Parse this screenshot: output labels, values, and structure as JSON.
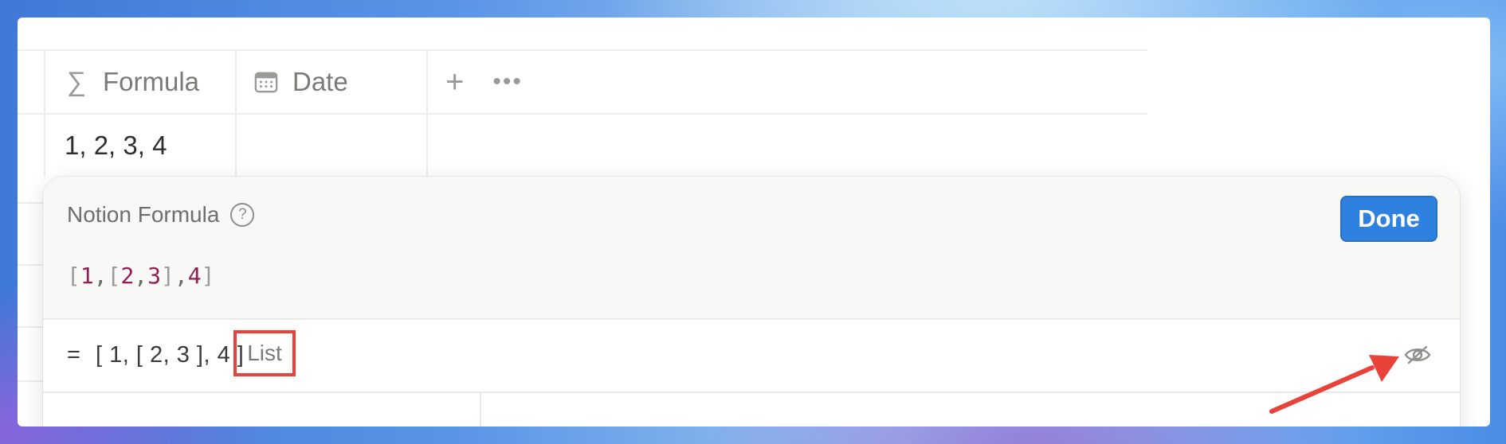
{
  "table": {
    "headers": [
      {
        "icon": "sigma-icon",
        "glyph": "∑",
        "label": "Formula"
      },
      {
        "icon": "calendar-icon",
        "label": "Date"
      }
    ],
    "row1": {
      "formula_value": "1, 2, 3, 4"
    }
  },
  "popup": {
    "title": "Notion Formula",
    "help_glyph": "?",
    "done_label": "Done",
    "formula": {
      "lb1": "[",
      "n1": "1",
      "c1": ",",
      "lb2": "[",
      "n2": "2",
      "c2": ",",
      "n3": "3",
      "rb2": "]",
      "c3": ",",
      "n4": "4",
      "rb1": "]"
    },
    "result": {
      "equals": "=",
      "value": "[ 1, [ 2, 3 ], 4 ]",
      "type": "List"
    }
  },
  "colors": {
    "accent": "#2f81e0",
    "highlight_box": "#e8423a",
    "number_token": "#911f52"
  }
}
